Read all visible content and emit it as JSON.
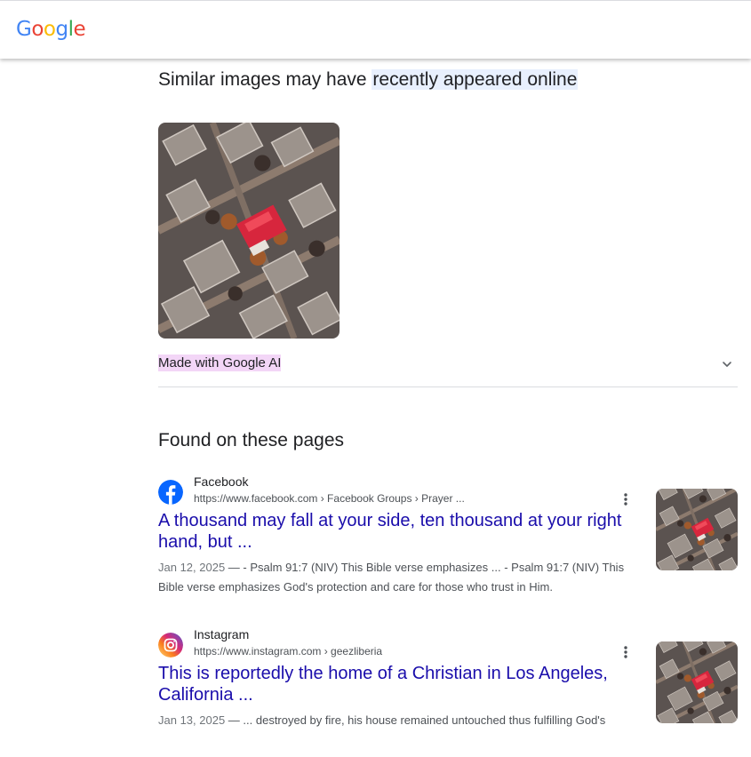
{
  "header": {
    "logo": [
      "G",
      "o",
      "o",
      "g",
      "l",
      "e"
    ],
    "logo_colors": [
      "#4285F4",
      "#EA4335",
      "#FBBC05",
      "#4285F4",
      "#34A853",
      "#EA4335"
    ]
  },
  "similar": {
    "title_prefix": "Similar images may have ",
    "title_highlight": "recently appeared online",
    "image_icon": "aerial-burned-neighborhood-photo",
    "ai_label": "Made with Google AI",
    "chevron_icon": "chevron-down-icon"
  },
  "found": {
    "title": "Found on these pages",
    "results": [
      {
        "site": "Facebook",
        "url": "https://www.facebook.com › Facebook Groups › Prayer ...",
        "title": "A thousand may fall at your side, ten thousand at your right hand, but ...",
        "date": "Jan 12, 2025",
        "snippet": " — - Psalm 91:7 (NIV) This Bible verse emphasizes ... - Psalm 91:7 (NIV) This Bible verse emphasizes God's protection and care for those who trust in Him.",
        "icon": "facebook-icon",
        "accent": "#0866ff"
      },
      {
        "site": "Instagram",
        "url": "https://www.instagram.com › geezliberia",
        "title": "This is reportedly the home of a Christian in Los Angeles, California ...",
        "date": "Jan 13, 2025",
        "snippet": " — ... destroyed by fire, his house remained untouched thus fulfilling God's",
        "icon": "instagram-icon",
        "accent": "#e1306c"
      }
    ]
  },
  "colors": {
    "link": "#1a0dab",
    "highlight_blue": "#e8f0fe",
    "highlight_purple": "#f3d6f7",
    "house_roof": "#d7263d"
  }
}
